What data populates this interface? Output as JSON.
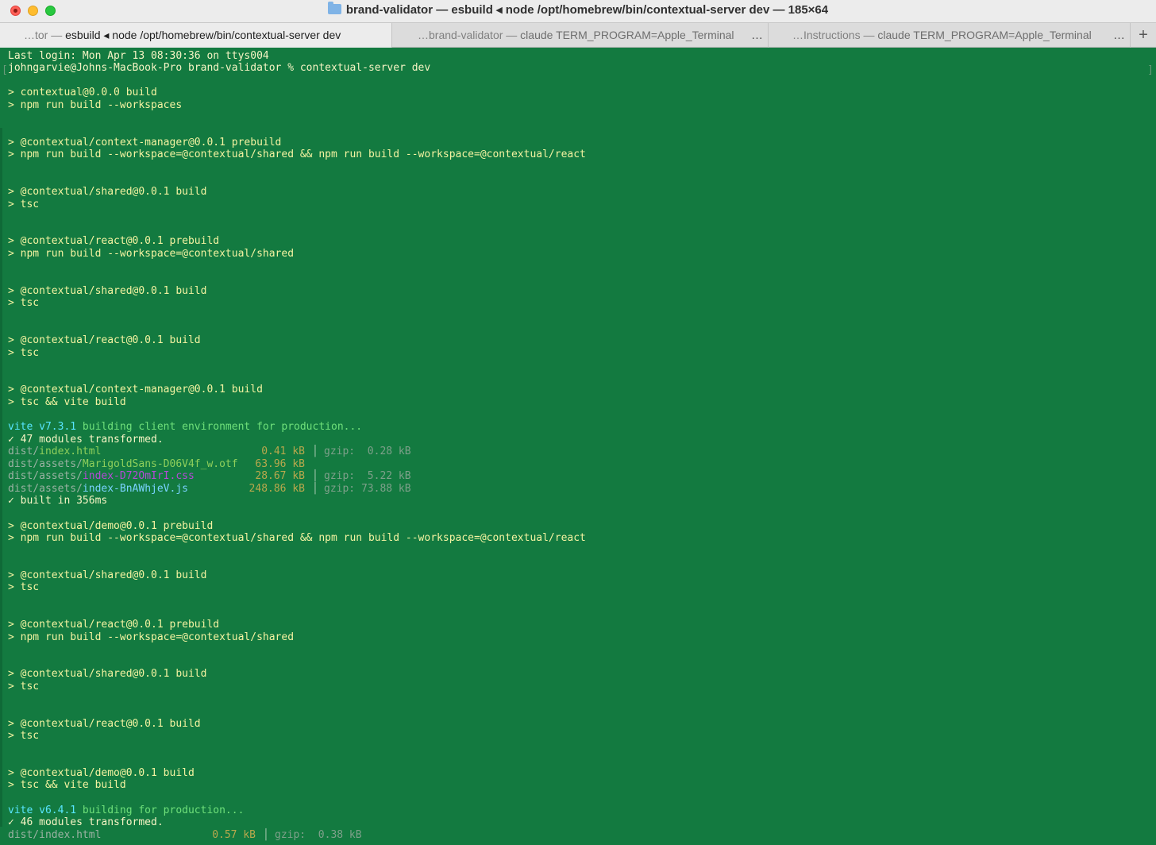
{
  "window": {
    "title": "brand-validator — esbuild ◂ node /opt/homebrew/bin/contextual-server dev — 185×64"
  },
  "tabs": [
    {
      "prefix": "…tor — ",
      "main": "esbuild ◂ node /opt/homebrew/bin/contextual-server dev",
      "active": true
    },
    {
      "prefix": "…brand-validator — ",
      "main": "claude TERM_PROGRAM=Apple_Terminal",
      "active": false,
      "ellipsis": "…"
    },
    {
      "prefix": "…Instructions — ",
      "main": "claude TERM_PROGRAM=Apple_Terminal",
      "active": false,
      "ellipsis": "…"
    }
  ],
  "new_tab_label": "+",
  "terminal": {
    "last_login": "Last login: Mon Apr 13 08:30:36 on ttys004",
    "prompt": "johngarvie@Johns-MacBook-Pro brand-validator % contextual-server dev",
    "l1": "> contextual@0.0.0 build",
    "l2": "> npm run build --workspaces",
    "l3": "> @contextual/context-manager@0.0.1 prebuild",
    "l4": "> npm run build --workspace=@contextual/shared && npm run build --workspace=@contextual/react",
    "l5": "> @contextual/shared@0.0.1 build",
    "l6": "> tsc",
    "l7": "> @contextual/react@0.0.1 prebuild",
    "l8": "> npm run build --workspace=@contextual/shared",
    "l9": "> @contextual/shared@0.0.1 build",
    "l10": "> tsc",
    "l11": "> @contextual/react@0.0.1 build",
    "l12": "> tsc",
    "l13": "> @contextual/context-manager@0.0.1 build",
    "l14": "> tsc && vite build",
    "vite1": {
      "name": "vite v7.3.1",
      "msg": " building client environment for production..."
    },
    "mods1": "✓ 47 modules transformed.",
    "files1": [
      {
        "dir": "dist/",
        "file": "index.html",
        "size": "0.41 kB",
        "gzip": "gzip:  0.28 kB"
      },
      {
        "dir": "dist/assets/",
        "file": "MarigoldSans-D06V4f_w.otf",
        "size": "63.96 kB",
        "gzip": ""
      },
      {
        "dir": "dist/assets/",
        "file": "index-D72OmIrI.css",
        "size": "28.67 kB",
        "gzip": "gzip:  5.22 kB"
      },
      {
        "dir": "dist/assets/",
        "file": "index-BnAWhjeV.js",
        "size": "248.86 kB",
        "gzip": "gzip: 73.88 kB"
      }
    ],
    "built1": "✓ built in 356ms",
    "l15": "> @contextual/demo@0.0.1 prebuild",
    "l16": "> npm run build --workspace=@contextual/shared && npm run build --workspace=@contextual/react",
    "l17": "> @contextual/shared@0.0.1 build",
    "l18": "> tsc",
    "l19": "> @contextual/react@0.0.1 prebuild",
    "l20": "> npm run build --workspace=@contextual/shared",
    "l21": "> @contextual/shared@0.0.1 build",
    "l22": "> tsc",
    "l23": "> @contextual/react@0.0.1 build",
    "l24": "> tsc",
    "l25": "> @contextual/demo@0.0.1 build",
    "l26": "> tsc && vite build",
    "vite2": {
      "name": "vite v6.4.1",
      "msg": " building for production..."
    },
    "mods2": "✓ 46 modules transformed.",
    "files2": [
      {
        "dir": "dist/",
        "file": "index.html",
        "size": "0.57 kB",
        "gzip": "gzip:  0.38 kB"
      }
    ],
    "bracket_left": "[",
    "bracket_right": "]"
  },
  "colors": {
    "terminal_bg": "#137a40",
    "text_yellow": "#f4f3a1",
    "vite_cyan": "#58e6ff",
    "success_green": "#6fe07a"
  }
}
